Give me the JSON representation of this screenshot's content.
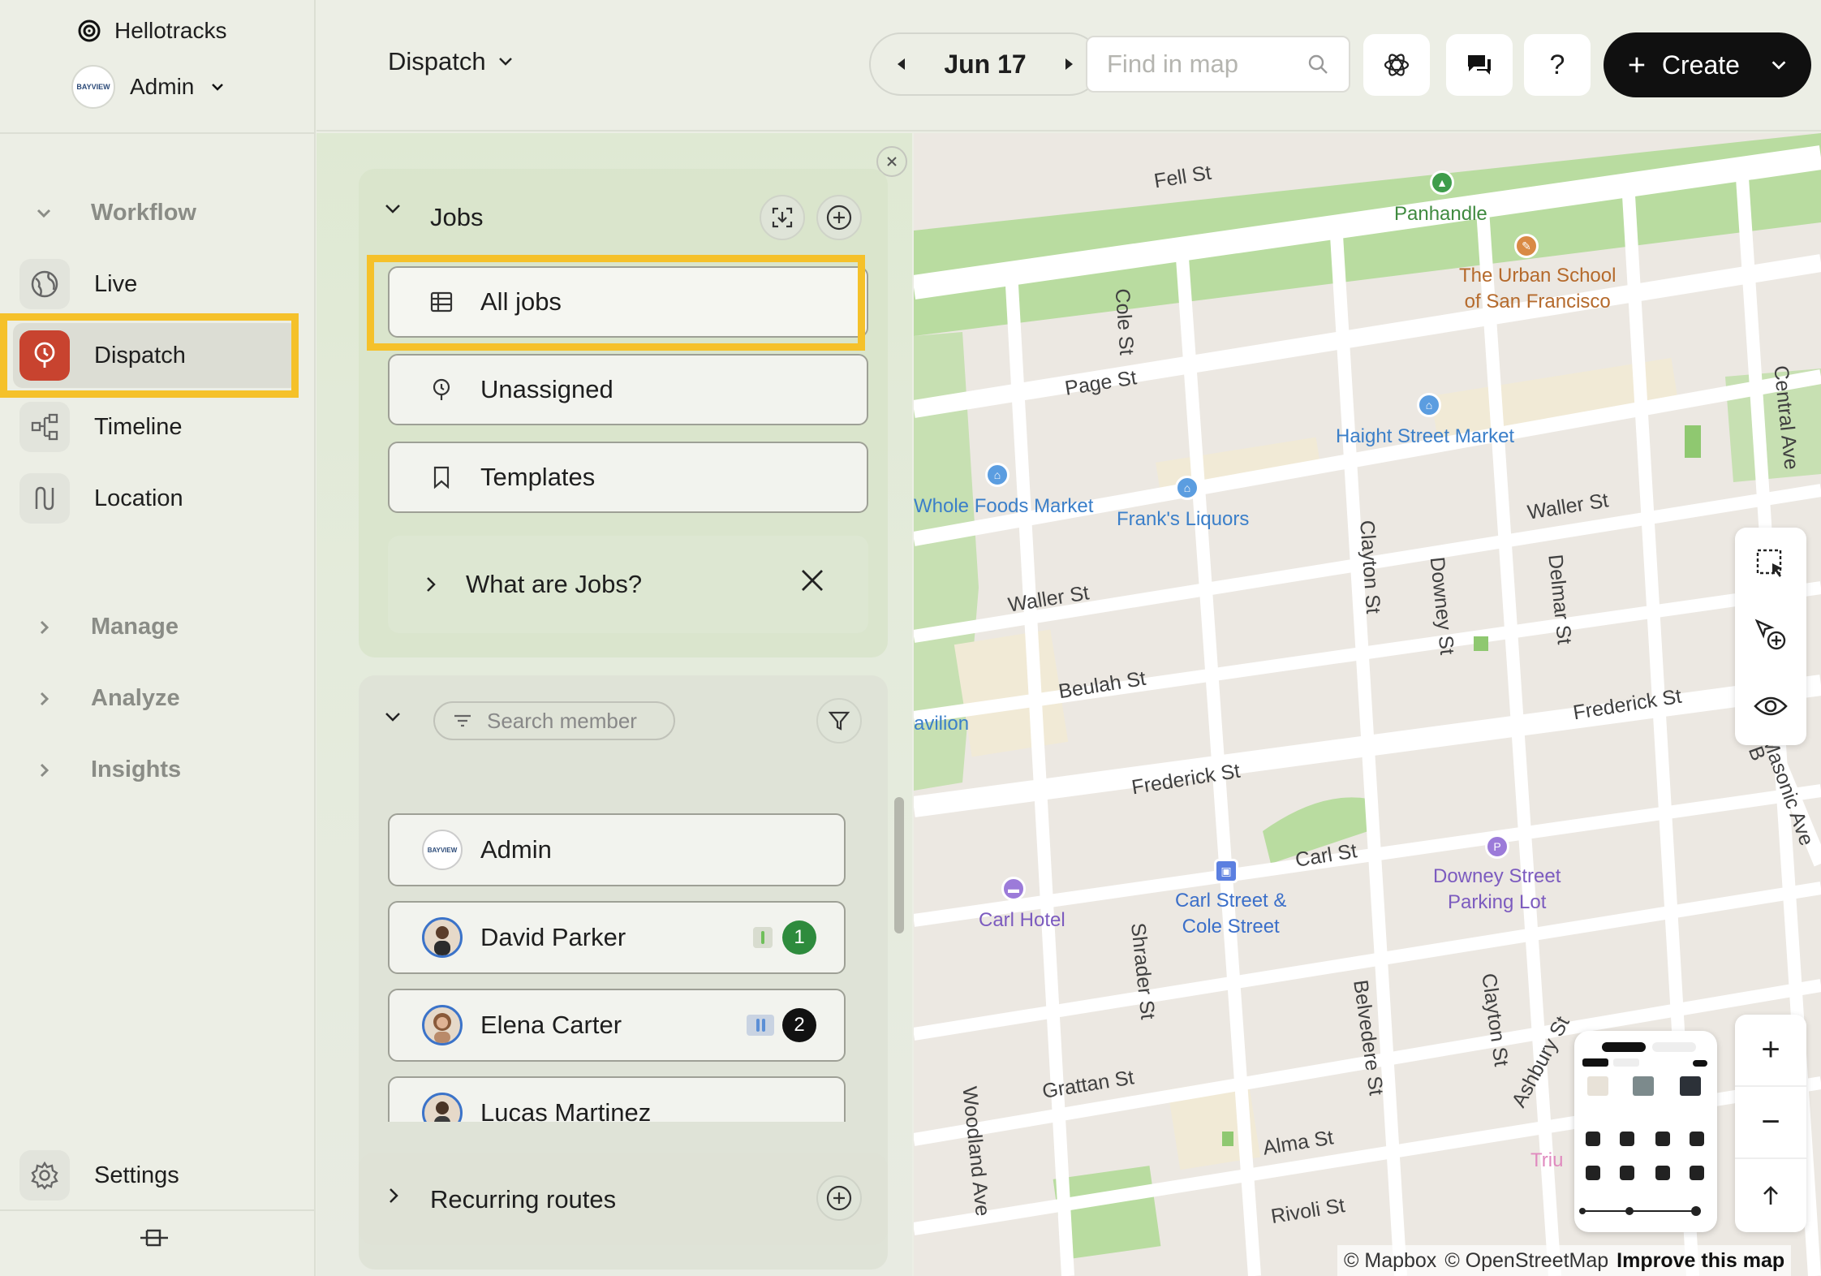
{
  "sidebar": {
    "org_name": "Hellotracks",
    "user_name": "Admin",
    "avatar_text": "BAYVIEW",
    "sections": {
      "workflow": "Workflow",
      "manage": "Manage",
      "analyze": "Analyze",
      "insights": "Insights"
    },
    "nav": {
      "live": "Live",
      "dispatch": "Dispatch",
      "timeline": "Timeline",
      "location": "Location",
      "settings": "Settings"
    },
    "active_item": "Dispatch"
  },
  "topbar": {
    "title": "Dispatch",
    "date": "Jun 17",
    "find_placeholder": "Find in map",
    "help_label": "?",
    "create_label": "Create"
  },
  "panel": {
    "jobs_title": "Jobs",
    "items": {
      "all_jobs": "All jobs",
      "unassigned": "Unassigned",
      "templates": "Templates"
    },
    "info": "What are Jobs?",
    "search_member_placeholder": "Search member",
    "members": [
      {
        "name": "Admin"
      },
      {
        "name": "David Parker",
        "count": "1",
        "badge_color": "#2e8b3d"
      },
      {
        "name": "Elena Carter",
        "count": "2",
        "badge_color": "#111111"
      },
      {
        "name": "Lucas Martinez"
      }
    ],
    "recurring_title": "Recurring routes"
  },
  "map": {
    "streets": {
      "fell": "Fell St",
      "page": "Page St",
      "waller_w": "Waller St",
      "waller_e": "Waller St",
      "beulah": "Beulah St",
      "frederick_w": "Frederick St",
      "frederick_e": "Frederick St",
      "carl": "Carl St",
      "grattan": "Grattan St",
      "alma": "Alma St",
      "rivoli": "Rivoli St",
      "cole": "Cole St",
      "clayton_n": "Clayton St",
      "clayton_s": "Clayton St",
      "downey": "Downey St",
      "delmar": "Delmar St",
      "central": "Central Ave",
      "masonic": "Masonic Ave",
      "shrader": "Shrader St",
      "belvedere": "Belvedere St",
      "ashbury": "Ashbury St",
      "woodland": "Woodland Ave",
      "b_label": "B"
    },
    "pois": {
      "panhandle": "Panhandle",
      "urban_school": "The Urban School\nof San Francisco",
      "haight_market": "Haight Street Market",
      "whole_foods": "Whole Foods Market",
      "franks": "Frank's Liquors",
      "pavilion": "avilion",
      "carl_hotel": "Carl Hotel",
      "carl_cole": "Carl Street &\nCole Street",
      "downey_parking": "Downey Street\nParking Lot",
      "triu": "Triu"
    },
    "attribution": {
      "mapbox": "© Mapbox",
      "osm": "© OpenStreetMap",
      "improve": "Improve this map"
    },
    "zoom_in": "+",
    "zoom_out": "−"
  },
  "colors": {
    "accent_dispatch": "#c8432f",
    "highlight": "#f5c12a",
    "park": "#b9dca0",
    "poi_blue": "#5b9de0",
    "poi_purple": "#9c7bd9",
    "poi_orange": "#d98a45"
  }
}
